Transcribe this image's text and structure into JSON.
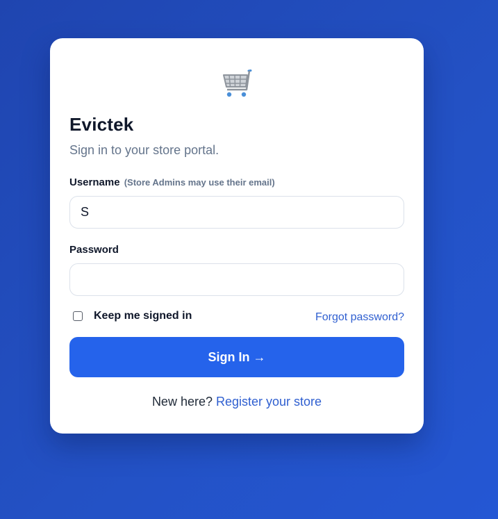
{
  "brand": {
    "logo_icon": "shopping-cart-icon",
    "name": "Evictek",
    "subtitle": "Sign in to your store portal."
  },
  "form": {
    "username": {
      "label": "Username",
      "hint": "(Store Admins may use their email)",
      "value": "S"
    },
    "password": {
      "label": "Password",
      "value": ""
    },
    "remember": {
      "label": "Keep me signed in",
      "checked": false
    },
    "forgot_label": "Forgot password?",
    "submit_label": "Sign In →"
  },
  "footer": {
    "prompt": "New here?",
    "link_label": "Register your store"
  },
  "colors": {
    "background": "#2351c4",
    "accent": "#2563eb",
    "link": "#2f5fd0",
    "heading": "#0f172a",
    "muted": "#64748b"
  }
}
